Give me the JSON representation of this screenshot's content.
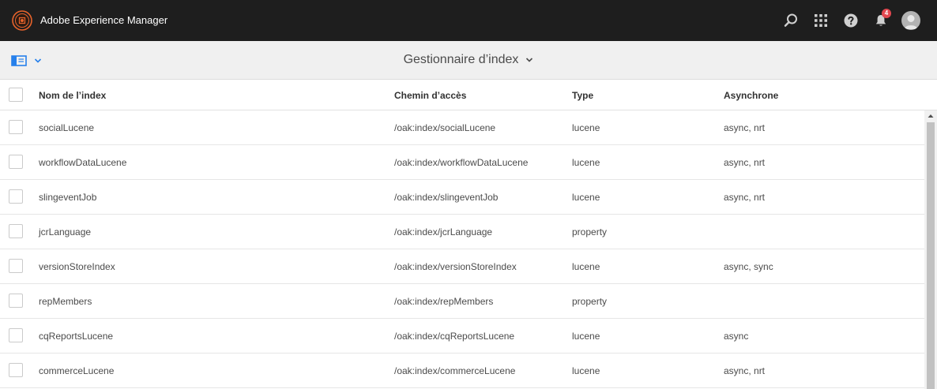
{
  "shell": {
    "app_title": "Adobe Experience Manager",
    "notification_count": "4",
    "icons": [
      "adobe-experience-manager-logo-icon",
      "search-icon",
      "solutions-grid-icon",
      "help-icon",
      "notifications-bell-icon",
      "user-avatar-icon"
    ]
  },
  "actionbar": {
    "title": "Gestionnaire d’index",
    "rail_toggle_icon": "rail-toggle-icon"
  },
  "table": {
    "columns": [
      "Nom de l’index",
      "Chemin d’accès",
      "Type",
      "Asynchrone"
    ],
    "rows": [
      {
        "name": "socialLucene",
        "path": "/oak:index/socialLucene",
        "type": "lucene",
        "async": "async, nrt"
      },
      {
        "name": "workflowDataLucene",
        "path": "/oak:index/workflowDataLucene",
        "type": "lucene",
        "async": "async, nrt"
      },
      {
        "name": "slingeventJob",
        "path": "/oak:index/slingeventJob",
        "type": "lucene",
        "async": "async, nrt"
      },
      {
        "name": "jcrLanguage",
        "path": "/oak:index/jcrLanguage",
        "type": "property",
        "async": ""
      },
      {
        "name": "versionStoreIndex",
        "path": "/oak:index/versionStoreIndex",
        "type": "lucene",
        "async": "async, sync"
      },
      {
        "name": "repMembers",
        "path": "/oak:index/repMembers",
        "type": "property",
        "async": ""
      },
      {
        "name": "cqReportsLucene",
        "path": "/oak:index/cqReportsLucene",
        "type": "lucene",
        "async": "async"
      },
      {
        "name": "commerceLucene",
        "path": "/oak:index/commerceLucene",
        "type": "lucene",
        "async": "async, nrt"
      }
    ]
  },
  "colors": {
    "shell_bg": "#1e1e1e",
    "actionbar_bg": "#f0f0f0",
    "accent": "#2680eb",
    "badge": "#e34850"
  }
}
